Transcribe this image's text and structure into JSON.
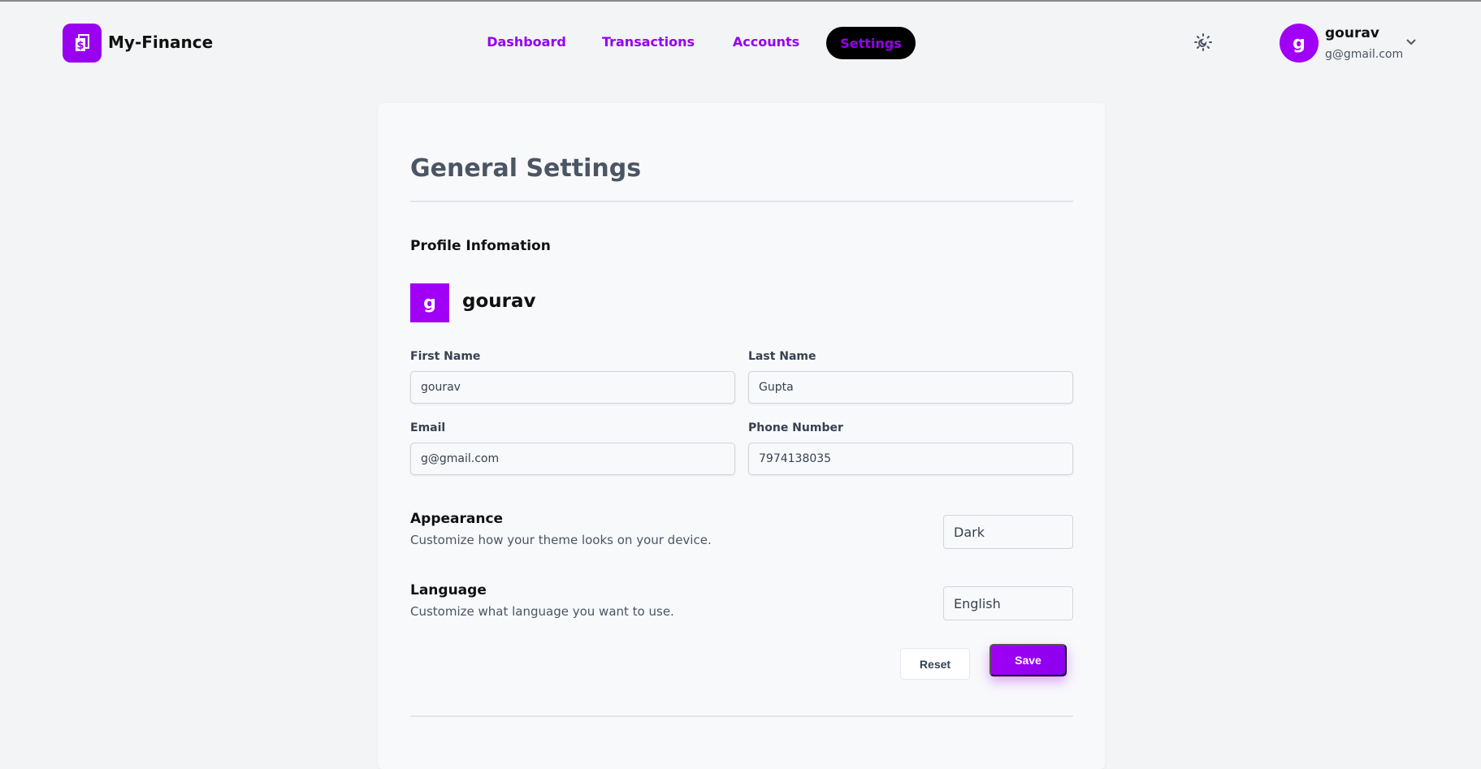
{
  "app": {
    "name": "My-Finance"
  },
  "nav": {
    "items": [
      {
        "label": "Dashboard"
      },
      {
        "label": "Transactions"
      },
      {
        "label": "Accounts"
      },
      {
        "label": "Settings",
        "active": true
      }
    ]
  },
  "user": {
    "initial": "g",
    "name": "gourav",
    "email": "g@gmail.com"
  },
  "settings": {
    "title": "General Settings",
    "profile_heading": "Profile Infomation",
    "avatar_initial": "g",
    "display_name": "gourav",
    "fields": {
      "first_name": {
        "label": "First Name",
        "value": "gourav"
      },
      "last_name": {
        "label": "Last Name",
        "value": "Gupta"
      },
      "email": {
        "label": "Email",
        "value": "g@gmail.com"
      },
      "phone": {
        "label": "Phone Number",
        "value": "7974138035"
      }
    },
    "appearance": {
      "title": "Appearance",
      "description": "Customize how your theme looks on your device.",
      "value": "Dark"
    },
    "language": {
      "title": "Language",
      "description": "Customize what language you want to use.",
      "value": "English"
    },
    "reset_label": "Reset",
    "save_label": "Save"
  },
  "colors": {
    "accent": "#9900ef",
    "background": "#f3f4f6"
  }
}
